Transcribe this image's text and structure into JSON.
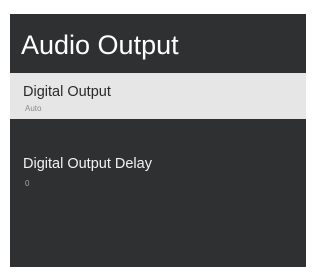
{
  "screen": {
    "title": "Audio Output"
  },
  "menu": {
    "items": [
      {
        "label": "Digital Output",
        "value": "Auto",
        "selected": true
      },
      {
        "label": "Digital Output Delay",
        "value": "0",
        "selected": false
      }
    ]
  },
  "colors": {
    "panel_background": "#2f3032",
    "selected_item_background": "#e6e6e6",
    "title_text": "#ffffff"
  }
}
